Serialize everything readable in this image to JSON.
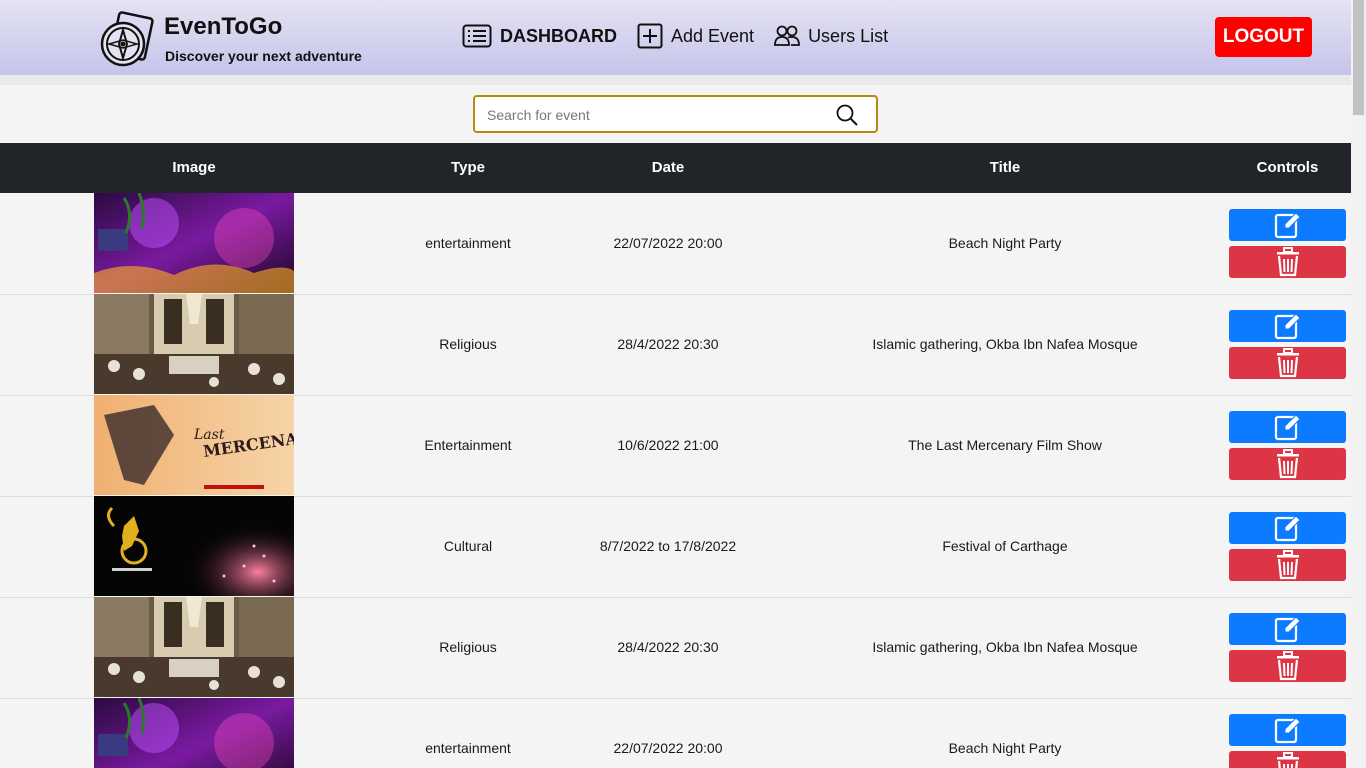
{
  "header": {
    "brand": "EvenToGo",
    "tagline": "Discover your next adventure",
    "nav": [
      {
        "label": "DASHBOARD",
        "icon": "list-icon"
      },
      {
        "label": "Add Event",
        "icon": "plus-square-icon"
      },
      {
        "label": "Users List",
        "icon": "users-icon"
      }
    ],
    "logout_label": "LOGOUT"
  },
  "search": {
    "placeholder": "Search for event",
    "value": ""
  },
  "table": {
    "columns": [
      "Image",
      "Type",
      "Date",
      "Title",
      "Controls"
    ],
    "rows": [
      {
        "image": "beach-party-photo",
        "type": "entertainment",
        "date": "22/07/2022 20:00",
        "title": "Beach Night Party"
      },
      {
        "image": "mosque-gathering-photo",
        "type": "Religious",
        "date": "28/4/2022 20:30",
        "title": "Islamic gathering, Okba Ibn Nafea Mosque"
      },
      {
        "image": "film-poster-photo",
        "type": "Entertainment",
        "date": "10/6/2022 21:00",
        "title": "The Last Mercenary Film Show"
      },
      {
        "image": "carthage-festival-photo",
        "type": "Cultural",
        "date": "8/7/2022 to 17/8/2022",
        "title": "Festival of Carthage"
      },
      {
        "image": "mosque-gathering-photo",
        "type": "Religious",
        "date": "28/4/2022 20:30",
        "title": "Islamic gathering, Okba Ibn Nafea Mosque"
      },
      {
        "image": "beach-party-photo",
        "type": "entertainment",
        "date": "22/07/2022 20:00",
        "title": "Beach Night Party"
      }
    ]
  },
  "colors": {
    "header_gradient_top": "#e4e3f2",
    "header_gradient_bottom": "#c6c4ea",
    "logout": "#ff0000",
    "table_head": "#212529",
    "edit_button": "#0d7bff",
    "delete_button": "#dc3545",
    "search_border": "#b58a14"
  }
}
